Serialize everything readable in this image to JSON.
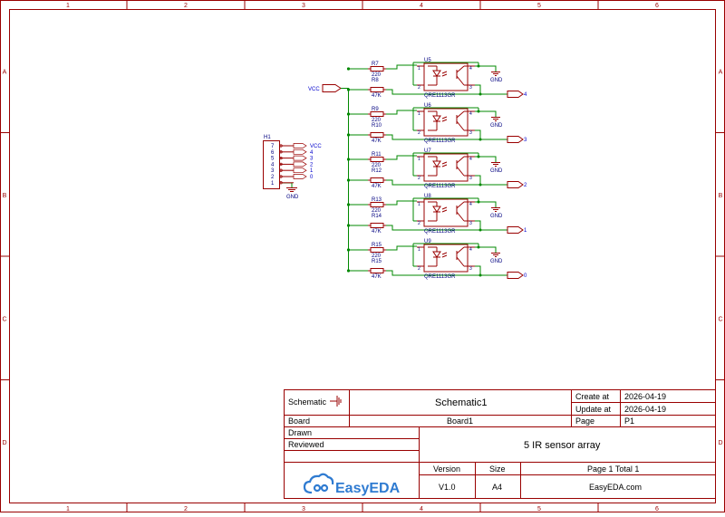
{
  "frame": {
    "col_labels": [
      "1",
      "2",
      "3",
      "4",
      "5",
      "6"
    ],
    "row_labels": [
      "A",
      "B",
      "C",
      "D"
    ]
  },
  "header": {
    "netport_label": "VCC",
    "header_ref": "H1",
    "header_pins": [
      "7",
      "6",
      "5",
      "4",
      "3",
      "2",
      "1"
    ],
    "header_nets": [
      "VCC",
      "4",
      "3",
      "2",
      "1",
      "0"
    ],
    "header_gnd": "GND"
  },
  "channels": [
    {
      "r_top": "R7",
      "r_top_val": "220",
      "r_bot": "R8",
      "r_bot_val": "47K",
      "u": "U5",
      "part": "QRE1113GR",
      "out": "4",
      "gnd": "GND"
    },
    {
      "r_top": "R9",
      "r_top_val": "220",
      "r_bot": "R10",
      "r_bot_val": "47K",
      "u": "U6",
      "part": "QRE1113GR",
      "out": "3",
      "gnd": "GND"
    },
    {
      "r_top": "R11",
      "r_top_val": "220",
      "r_bot": "R12",
      "r_bot_val": "47K",
      "u": "U7",
      "part": "QRE1113GR",
      "out": "2",
      "gnd": "GND"
    },
    {
      "r_top": "R13",
      "r_top_val": "220",
      "r_bot": "R14",
      "r_bot_val": "47K",
      "u": "U8",
      "part": "QRE1113GR",
      "out": "1",
      "gnd": "GND"
    },
    {
      "r_top": "R15",
      "r_top_val": "220",
      "r_bot": "R15",
      "r_bot_val": "47K",
      "u": "U9",
      "part": "QRE1113GR",
      "out": "0",
      "gnd": "GND"
    }
  ],
  "pin_numbers": {
    "p1": "1",
    "p2": "2",
    "p3": "3",
    "p4": "4"
  },
  "title_block": {
    "schematic_label": "Schematic",
    "schematic_name": "Schematic1",
    "create_label": "Create at",
    "create_date": "2026-04-19",
    "update_label": "Update at",
    "update_date": "2026-04-19",
    "board_label": "Board",
    "board_name": "Board1",
    "page_label": "Page",
    "page_value": "P1",
    "drawn_label": "Drawn",
    "reviewed_label": "Reviewed",
    "title": "5 IR sensor array",
    "version_label": "Version",
    "version_value": "V1.0",
    "size_label": "Size",
    "size_value": "A4",
    "page_count": "Page  1  Total  1",
    "website": "EasyEDA.com",
    "logo_text": "EasyEDA"
  },
  "colors": {
    "frame": "#990000",
    "wire": "#008800",
    "component": "#990000",
    "text": "#000080",
    "net": "#0000cc",
    "logo": "#2f7bd1"
  }
}
